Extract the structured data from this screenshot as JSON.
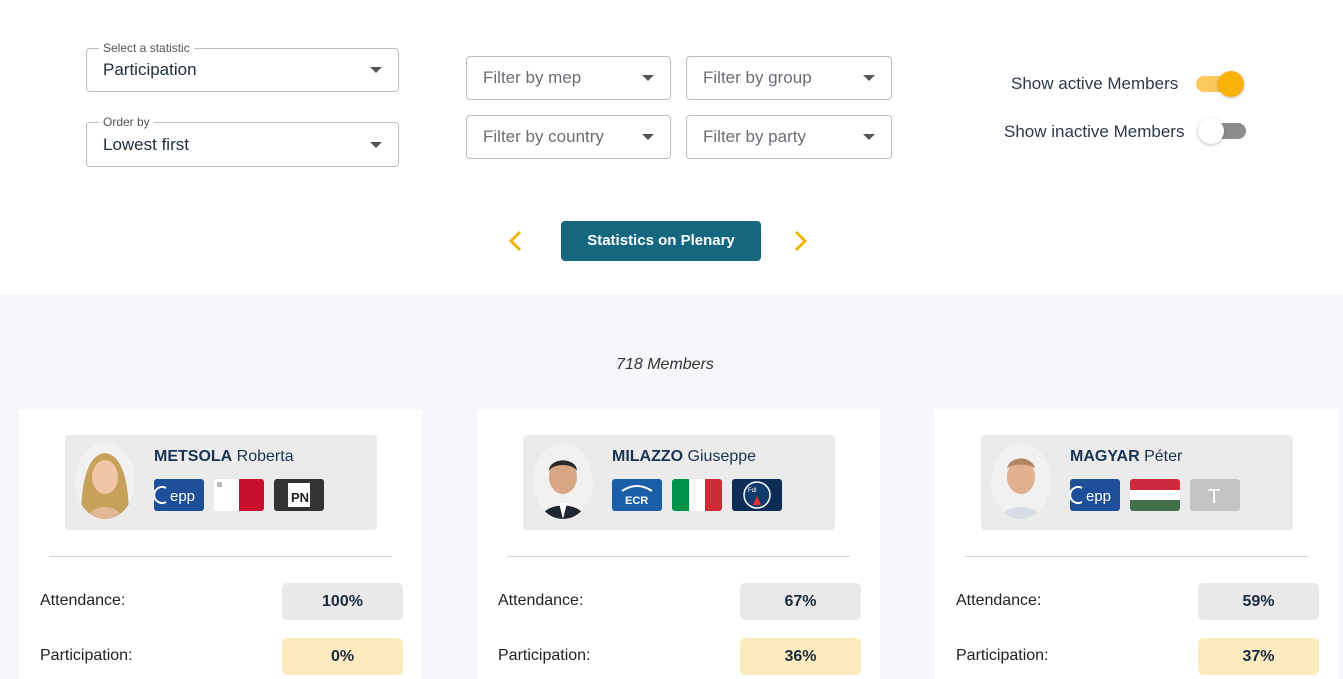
{
  "filters": {
    "statistic": {
      "legend": "Select a statistic",
      "value": "Participation"
    },
    "order": {
      "legend": "Order by",
      "value": "Lowest first"
    },
    "mep": "Filter by mep",
    "group": "Filter by group",
    "country": "Filter by country",
    "party": "Filter by party"
  },
  "toggles": {
    "active": {
      "label": "Show active Members",
      "on": true
    },
    "inactive": {
      "label": "Show inactive Members",
      "on": false
    }
  },
  "nav": {
    "title": "Statistics on Plenary"
  },
  "members_count": "718 Members",
  "colors": {
    "accent": "#14677f",
    "toggle_on": "#f9b208",
    "value_highlight": "#fdebc0"
  },
  "cards": [
    {
      "last": "METSOLA",
      "first": "Roberta",
      "badges": [
        "epp-logo",
        "malta-flag",
        "pn-party-logo"
      ],
      "badge_text": [
        "epp",
        "",
        "PN"
      ],
      "attendance_label": "Attendance:",
      "attendance": "100%",
      "participation_label": "Participation:",
      "participation": "0%"
    },
    {
      "last": "MILAZZO",
      "first": "Giuseppe",
      "badges": [
        "ecr-logo",
        "italy-flag",
        "fratelli-d-italia-logo"
      ],
      "badge_text": [
        "ECR",
        "",
        "FdI"
      ],
      "attendance_label": "Attendance:",
      "attendance": "67%",
      "participation_label": "Participation:",
      "participation": "36%"
    },
    {
      "last": "MAGYAR",
      "first": "Péter",
      "badges": [
        "epp-logo",
        "hungary-flag",
        "tisza-party-logo"
      ],
      "badge_text": [
        "epp",
        "",
        "T"
      ],
      "attendance_label": "Attendance:",
      "attendance": "59%",
      "participation_label": "Participation:",
      "participation": "37%"
    }
  ]
}
